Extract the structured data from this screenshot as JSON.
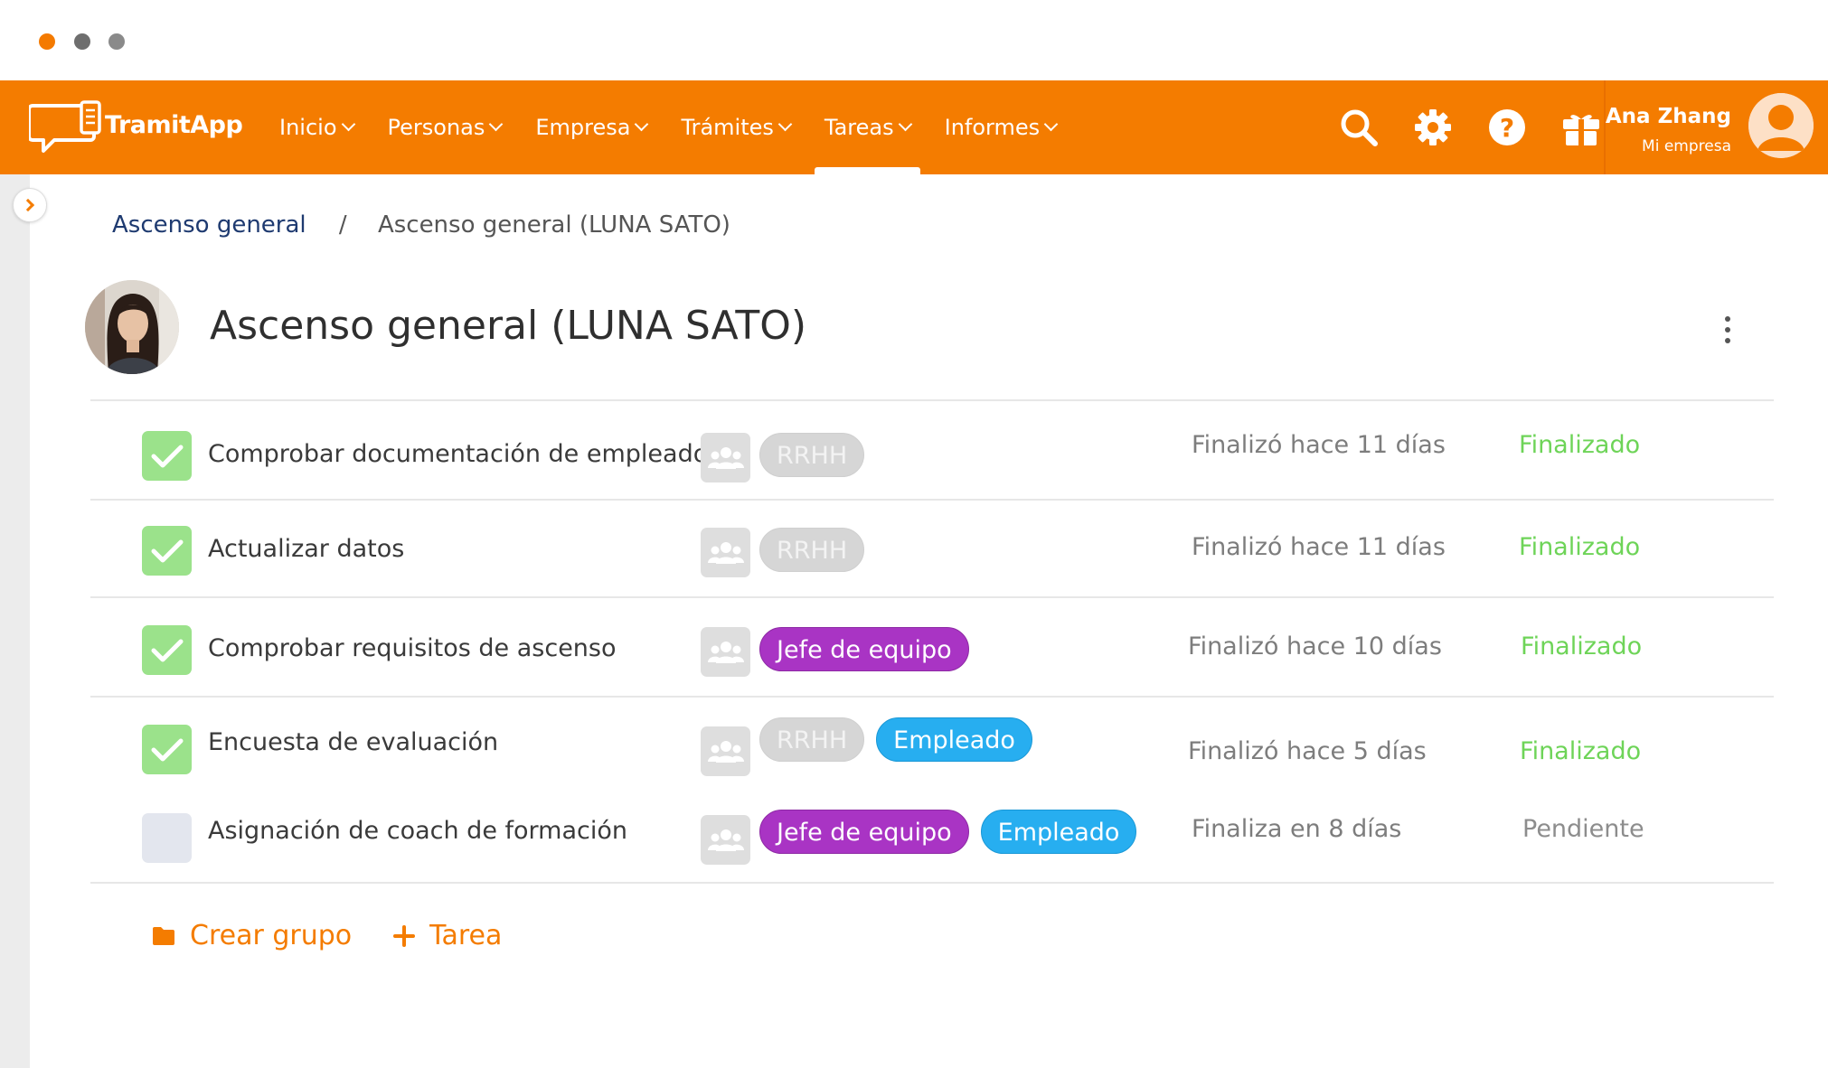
{
  "window": {
    "dot_colors": [
      "#f47a00",
      "#6e6e6e",
      "#8a8a8a"
    ]
  },
  "brand": {
    "name": "TramitApp",
    "accent": "#f47c00"
  },
  "nav": {
    "items": [
      {
        "label": "Inicio"
      },
      {
        "label": "Personas"
      },
      {
        "label": "Empresa"
      },
      {
        "label": "Trámites"
      },
      {
        "label": "Tareas",
        "active": true
      },
      {
        "label": "Informes"
      }
    ],
    "icons": [
      "search-icon",
      "gear-icon",
      "help-icon",
      "gift-icon"
    ]
  },
  "user": {
    "name": "Ana Zhang",
    "company": "Mi empresa"
  },
  "breadcrumb": {
    "parent": "Ascenso general",
    "separator": "/",
    "current": "Ascenso general (LUNA SATO)"
  },
  "process": {
    "title": "Ascenso general (LUNA SATO)"
  },
  "tasks": [
    {
      "name": "Comprobar documentación de empleado",
      "tags": [
        "RRHH"
      ],
      "due": "Finalizó hace 11 días",
      "status": "Finalizado",
      "done": true
    },
    {
      "name": "Actualizar datos",
      "tags": [
        "RRHH"
      ],
      "due": "Finalizó hace 11 días",
      "status": "Finalizado",
      "done": true
    },
    {
      "name": "Comprobar requisitos de ascenso",
      "tags": [
        "Jefe de equipo"
      ],
      "due": "Finalizó hace 10 días",
      "status": "Finalizado",
      "done": true
    },
    {
      "name": "Encuesta de evaluación",
      "tags": [
        "RRHH",
        "Empleado"
      ],
      "due": "Finalizó hace 5 días",
      "status": "Finalizado",
      "done": true
    },
    {
      "name": "Asignación de coach de formación",
      "tags": [
        "Jefe de equipo",
        "Empleado"
      ],
      "due": "Finaliza en 8 días",
      "status": "Pendiente",
      "done": false
    }
  ],
  "tag_colors": {
    "RRHH": "#d6d6d6",
    "Jefe de equipo": "#a934c4",
    "Empleado": "#27aef0"
  },
  "status_colors": {
    "Finalizado": "#6ed458",
    "Pendiente": "#8d8d8d"
  },
  "actions": {
    "create_group": "Crear grupo",
    "add_task": "Tarea"
  }
}
